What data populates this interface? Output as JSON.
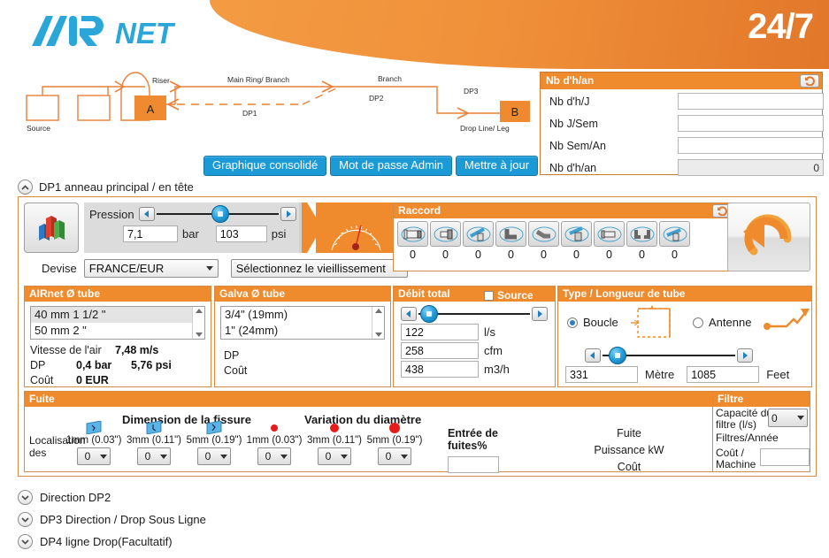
{
  "header": {
    "logo_text_1": "AIR",
    "logo_text_2": "NET",
    "badge": "24/7"
  },
  "diagram": {
    "labels": {
      "source": "Source",
      "riser": "Riser",
      "main_ring": "Main Ring/ Branch",
      "branch": "Branch",
      "dp1": "DP1",
      "dp2": "DP2",
      "dp3": "DP3",
      "drop_line": "Drop Line/ Leg",
      "node_a": "A",
      "node_b": "B"
    }
  },
  "toolbar": {
    "consolidated_chart": "Graphique consolidé",
    "admin_password": "Mot de passe Admin",
    "update": "Mettre à jour"
  },
  "hours_panel": {
    "title": "Nb d'h/an",
    "reset_icon": "undo-icon",
    "rows": [
      {
        "label": "Nb d'h/J",
        "value": "",
        "readonly": false
      },
      {
        "label": "Nb J/Sem",
        "value": "",
        "readonly": false
      },
      {
        "label": "Nb Sem/An",
        "value": "",
        "readonly": false
      },
      {
        "label": "Nb d'h/an",
        "value": "0",
        "readonly": true
      }
    ]
  },
  "sections": {
    "dp1": "DP1 anneau principal / en tête",
    "dp2": "Direction DP2",
    "dp3": "DP3 Direction / Drop Sous Ligne",
    "dp4": "DP4 ligne Drop(Facultatif)"
  },
  "pressure": {
    "label": "Pression",
    "bar_value": "7,1",
    "bar_unit": "bar",
    "psi_value": "103",
    "psi_unit": "psi",
    "chart_icon": "bar-chart-icon",
    "gauge_icon": "gauge-icon"
  },
  "currency": {
    "label": "Devise",
    "selected": "FRANCE/EUR",
    "aging_selected": "Sélectionnez le vieillissement"
  },
  "airnet_tube": {
    "title": "AIRnet Ø tube",
    "options": [
      "40 mm 1 1/2 \"",
      "50 mm 2 \""
    ],
    "rows": [
      {
        "label": "Vitesse de l'air",
        "value": "7,48 m/s",
        "value2": ""
      },
      {
        "label": "DP",
        "value": "0,4 bar",
        "value2": "5,76 psi"
      },
      {
        "label": "Coût",
        "value": "0 EUR",
        "value2": ""
      }
    ]
  },
  "galva_tube": {
    "title": "Galva Ø tube",
    "options": [
      "3/4\" (19mm)",
      "1\" (24mm)"
    ],
    "rows": [
      {
        "label": "DP",
        "value": ""
      },
      {
        "label": "Coût",
        "value": ""
      }
    ]
  },
  "raccord": {
    "title": "Raccord",
    "reset_icon": "undo-icon",
    "fittings": [
      {
        "icon": "coupling-icon",
        "value": "0"
      },
      {
        "icon": "reducer-icon",
        "value": "0"
      },
      {
        "icon": "tee-icon",
        "value": "0"
      },
      {
        "icon": "elbow-90-icon",
        "value": "0"
      },
      {
        "icon": "elbow-45-icon",
        "value": "0"
      },
      {
        "icon": "tee-outlet-icon",
        "value": "0"
      },
      {
        "icon": "union-icon",
        "value": "0"
      },
      {
        "icon": "double-elbow-icon",
        "value": "0"
      },
      {
        "icon": "tee-down-icon",
        "value": "0"
      }
    ],
    "undo_big_icon": "undo-large-icon"
  },
  "debit": {
    "title": "Débit total",
    "source_label": "Source",
    "source_checked": false,
    "rows": [
      {
        "value": "122",
        "unit": "l/s"
      },
      {
        "value": "258",
        "unit": "cfm"
      },
      {
        "value": "438",
        "unit": "m3/h"
      }
    ]
  },
  "tube_type": {
    "title": "Type / Longueur de tube",
    "loop_label": "Boucle",
    "loop_selected": true,
    "antenna_label": "Antenne",
    "antenna_selected": false,
    "metre_value": "331",
    "metre_unit": "Mètre",
    "feet_value": "1085",
    "feet_unit": "Feet"
  },
  "fuite": {
    "title": "Fuite",
    "localisation_label": "Localisation des",
    "group1_title": "Dimension de la fissure",
    "group2_title": "Variation du diamètre",
    "columns": [
      {
        "icon": "crack-icon",
        "label": "1mm (0.03\")",
        "value": "0"
      },
      {
        "icon": "crack-icon",
        "label": "3mm (0.11\")",
        "value": "0"
      },
      {
        "icon": "crack-icon",
        "label": "5mm (0.19\")",
        "value": "0"
      },
      {
        "icon": "hole-icon",
        "label": "1mm (0.03\")",
        "value": "0"
      },
      {
        "icon": "hole-icon",
        "label": "3mm (0.11\")",
        "value": "0"
      },
      {
        "icon": "hole-icon",
        "label": "5mm (0.19\")",
        "value": "0"
      }
    ],
    "entry_label": "Entrée de fuites%",
    "entry_value": "",
    "result_leak": "Fuite",
    "result_power": "Puissance kW",
    "result_cost": "Coût"
  },
  "filtre": {
    "title": "Filtre",
    "capacity_label": "Capacité du filtre (l/s)",
    "capacity_value": "0",
    "filters_per_year_label": "Filtres/Année",
    "cost_label": "Coût / Machine",
    "cost_value": ""
  },
  "colors": {
    "orange": "#ef8b2c",
    "orange_dark": "#e2772a",
    "blue_button": "#1c9ad6",
    "logo_blue": "#2ba6d9",
    "panel_border": "#d48c44",
    "red_dot": "#e81b1b"
  }
}
